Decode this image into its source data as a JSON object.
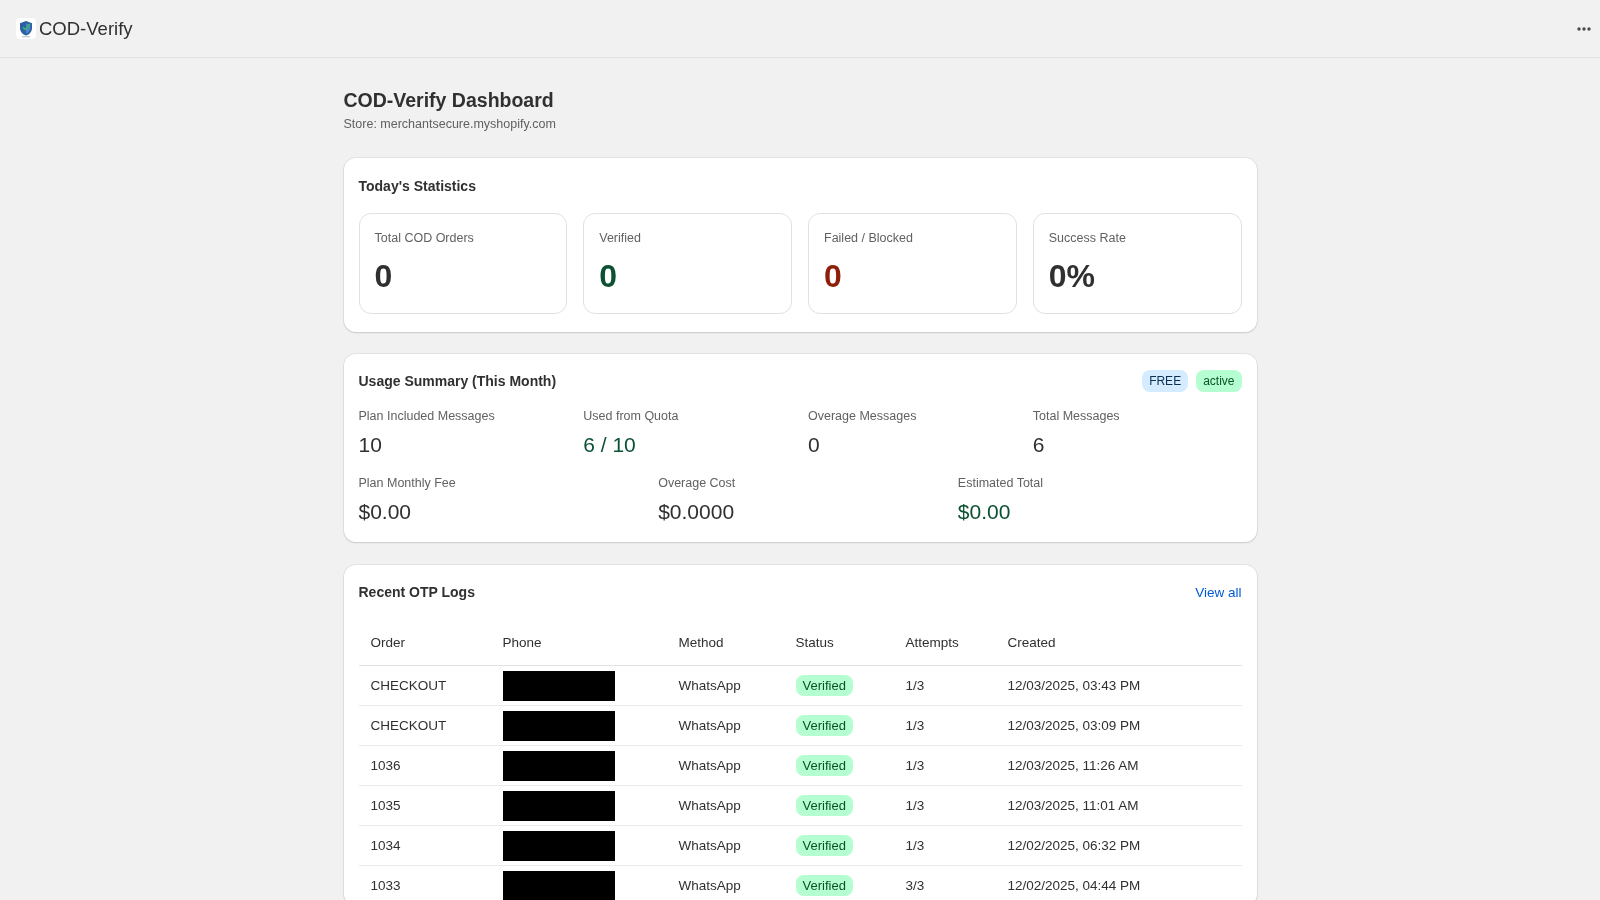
{
  "app_bar": {
    "title": "COD-Verify"
  },
  "page": {
    "title": "COD-Verify Dashboard",
    "subtitle": "Store: merchantsecure.myshopify.com"
  },
  "todays_statistics": {
    "title": "Today's Statistics",
    "stats": [
      {
        "label": "Total COD Orders",
        "value": "0",
        "color": "#303030"
      },
      {
        "label": "Verified",
        "value": "0",
        "color": "#0c5132"
      },
      {
        "label": "Failed / Blocked",
        "value": "0",
        "color": "#8e1f0b"
      },
      {
        "label": "Success Rate",
        "value": "0%",
        "color": "#303030"
      }
    ]
  },
  "usage_summary": {
    "title": "Usage Summary (This Month)",
    "badges": [
      {
        "label": "FREE",
        "color": "#d5ebff"
      },
      {
        "label": "active",
        "color": "#b4fed2"
      }
    ],
    "metric_rows": [
      {
        "metrics": [
          {
            "label": "Plan Included Messages",
            "value": "10",
            "color": "#303030"
          },
          {
            "label": "Used from Quota",
            "value": "6 / 10",
            "color": "#0c5132"
          },
          {
            "label": "Overage Messages",
            "value": "0",
            "color": "#303030"
          },
          {
            "label": "Total Messages",
            "value": "6",
            "color": "#303030"
          }
        ]
      },
      {
        "metrics": [
          {
            "label": "Plan Monthly Fee",
            "value": "$0.00",
            "color": "#303030"
          },
          {
            "label": "Overage Cost",
            "value": "$0.0000",
            "color": "#303030"
          },
          {
            "label": "Estimated Total",
            "value": "$0.00",
            "color": "#0c5132"
          }
        ]
      }
    ]
  },
  "recent_otp_logs": {
    "title": "Recent OTP Logs",
    "view_all": "View all",
    "columns": [
      "Order",
      "Phone",
      "Method",
      "Status",
      "Attempts",
      "Created"
    ],
    "rows": [
      {
        "order": "CHECKOUT",
        "phone_hidden": true,
        "method": "WhatsApp",
        "status": {
          "label": "Verified",
          "color": "#b4fed2"
        },
        "attempts": "1/3",
        "created": "12/03/2025, 03:43 PM"
      },
      {
        "order": "CHECKOUT",
        "phone_hidden": true,
        "method": "WhatsApp",
        "status": {
          "label": "Verified",
          "color": "#b4fed2"
        },
        "attempts": "1/3",
        "created": "12/03/2025, 03:09 PM"
      },
      {
        "order": "1036",
        "phone_hidden": true,
        "method": "WhatsApp",
        "status": {
          "label": "Verified",
          "color": "#b4fed2"
        },
        "attempts": "1/3",
        "created": "12/03/2025, 11:26 AM"
      },
      {
        "order": "1035",
        "phone_hidden": true,
        "method": "WhatsApp",
        "status": {
          "label": "Verified",
          "color": "#b4fed2"
        },
        "attempts": "1/3",
        "created": "12/03/2025, 11:01 AM"
      },
      {
        "order": "1034",
        "phone_hidden": true,
        "method": "WhatsApp",
        "status": {
          "label": "Verified",
          "color": "#b4fed2"
        },
        "attempts": "1/3",
        "created": "12/02/2025, 06:32 PM"
      },
      {
        "order": "1033",
        "phone_hidden": true,
        "method": "WhatsApp",
        "status": {
          "label": "Verified",
          "color": "#b4fed2"
        },
        "attempts": "3/3",
        "created": "12/02/2025, 04:44 PM"
      }
    ]
  }
}
